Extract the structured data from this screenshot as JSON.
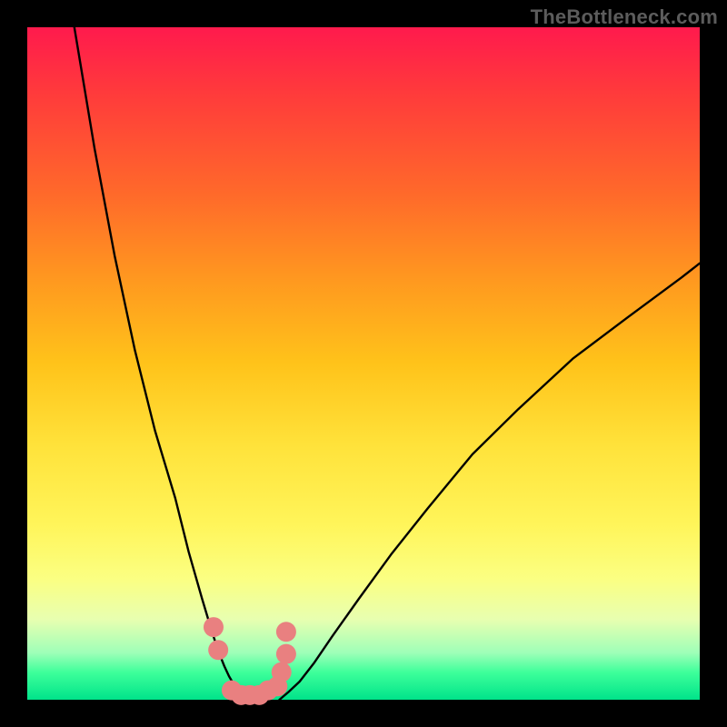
{
  "watermark": "TheBottleneck.com",
  "chart_data": {
    "type": "line",
    "title": "",
    "xlabel": "",
    "ylabel": "",
    "xlim": [
      0,
      100
    ],
    "ylim": [
      0,
      100
    ],
    "grid": false,
    "legend": false,
    "series": [
      {
        "name": "left-curve",
        "x": [
          7,
          10,
          13,
          16,
          19,
          22,
          24,
          26,
          27.5,
          28.5,
          29.3,
          30,
          30.7,
          31.5,
          32.5,
          34
        ],
        "y": [
          100,
          82,
          66,
          52,
          40,
          30,
          22,
          15,
          10,
          7,
          5,
          3.5,
          2.3,
          1.3,
          0.5,
          0
        ]
      },
      {
        "name": "right-curve",
        "x": [
          37.5,
          38.9,
          40.5,
          42.6,
          45.4,
          49.3,
          54.1,
          59.5,
          66.2,
          73,
          81.1,
          89.2,
          97.3,
          100
        ],
        "y": [
          0,
          1.2,
          2.7,
          5.4,
          9.5,
          15,
          21.6,
          28.4,
          36.5,
          43.2,
          50.7,
          56.8,
          62.8,
          64.9
        ]
      },
      {
        "name": "dots",
        "style": "scatter",
        "x": [
          27.7,
          28.4,
          30.4,
          31.8,
          33.1,
          34.5,
          35.8,
          37.2,
          37.8,
          38.5,
          38.5
        ],
        "y": [
          10.8,
          7.4,
          1.4,
          0.7,
          0.7,
          0.7,
          1.4,
          2,
          4.1,
          6.8,
          10.1
        ]
      }
    ],
    "background_gradient": {
      "direction": "top-to-bottom",
      "stops": [
        {
          "pos": 0.0,
          "color": "#ff1a4d"
        },
        {
          "pos": 0.5,
          "color": "#ffc31a"
        },
        {
          "pos": 0.82,
          "color": "#fbff82"
        },
        {
          "pos": 1.0,
          "color": "#00e38a"
        }
      ]
    },
    "colors": {
      "curve": "#000000",
      "dots": "#e98080",
      "frame": "#000000"
    }
  }
}
